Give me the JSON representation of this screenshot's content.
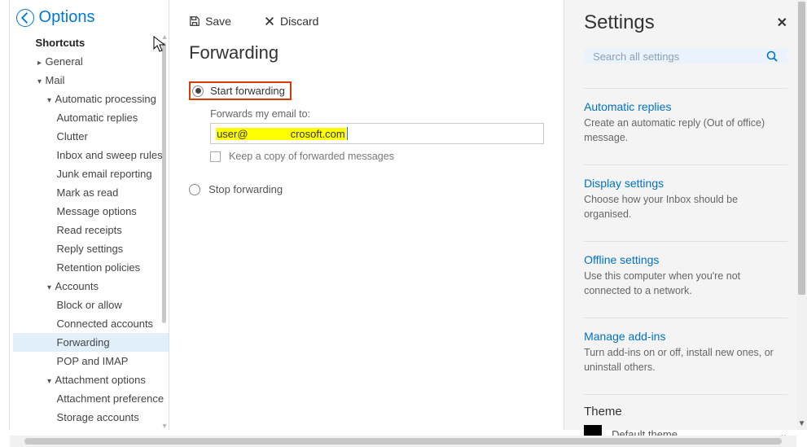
{
  "options": {
    "header": "Options",
    "tree": {
      "shortcuts": "Shortcuts",
      "general": "General",
      "mail": "Mail",
      "autoproc": "Automatic processing",
      "autoreplies": "Automatic replies",
      "clutter": "Clutter",
      "inboxsweep": "Inbox and sweep rules",
      "junk": "Junk email reporting",
      "markread": "Mark as read",
      "msgopts": "Message options",
      "readrcpt": "Read receipts",
      "replyset": "Reply settings",
      "retention": "Retention policies",
      "accounts": "Accounts",
      "blockallow": "Block or allow",
      "connected": "Connected accounts",
      "forwarding": "Forwarding",
      "popimap": "POP and IMAP",
      "attachopt": "Attachment options",
      "attachpref": "Attachment preference",
      "storage": "Storage accounts"
    }
  },
  "content": {
    "save": "Save",
    "discard": "Discard",
    "title": "Forwarding",
    "start": "Start forwarding",
    "forward_to_label": "Forwards my email to:",
    "email_prefix": "user@",
    "email_suffix": "crosoft.com",
    "keep_copy": "Keep a copy of forwarded messages",
    "stop": "Stop forwarding"
  },
  "settings": {
    "title": "Settings",
    "search_placeholder": "Search all settings",
    "links": [
      {
        "title": "Automatic replies",
        "desc": "Create an automatic reply (Out of office) message."
      },
      {
        "title": "Display settings",
        "desc": "Choose how your Inbox should be organised."
      },
      {
        "title": "Offline settings",
        "desc": "Use this computer when you're not connected to a network."
      },
      {
        "title": "Manage add-ins",
        "desc": "Turn add-ins on or off, install new ones, or uninstall others."
      }
    ],
    "theme_label": "Theme",
    "theme_value": "Default theme"
  }
}
